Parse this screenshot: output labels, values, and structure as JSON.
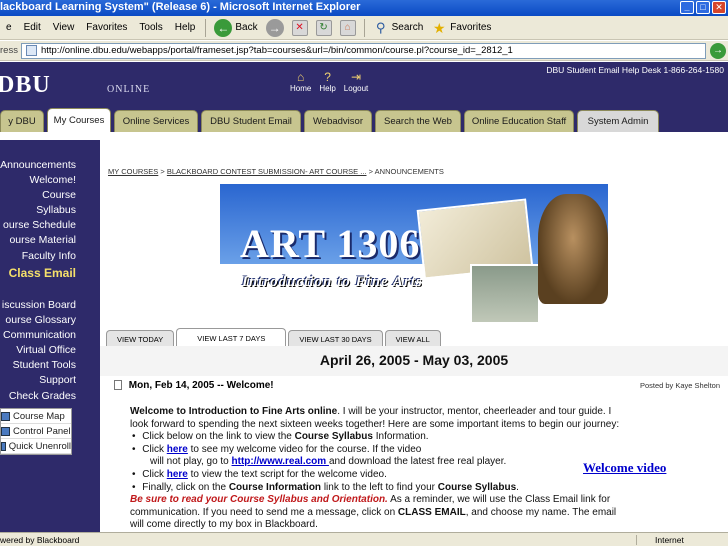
{
  "window": {
    "title": "lackboard Learning System\" (Release 6) - Microsoft Internet Explorer"
  },
  "menu": [
    "e",
    "Edit",
    "View",
    "Favorites",
    "Tools",
    "Help"
  ],
  "toolbar": {
    "back": "Back",
    "search": "Search",
    "favorites": "Favorites"
  },
  "address": {
    "label": "ress",
    "url": "http://online.dbu.edu/webapps/portal/frameset.jsp?tab=courses&url=/bin/common/course.pl?course_id=_2812_1"
  },
  "header": {
    "logo": "DBU",
    "online": "ONLINE",
    "icons": [
      {
        "name": "home-icon",
        "label": "Home"
      },
      {
        "name": "help-icon",
        "label": "Help"
      },
      {
        "name": "logout-icon",
        "label": "Logout"
      }
    ],
    "links": "DBU Student Email   Help Desk 1-866-264-1580"
  },
  "tabs": [
    {
      "label": "y DBU"
    },
    {
      "label": "My Courses"
    },
    {
      "label": "Online Services"
    },
    {
      "label": "DBU Student Email"
    },
    {
      "label": "Webadvisor"
    },
    {
      "label": "Search the Web"
    },
    {
      "label": "Online Education Staff"
    },
    {
      "label": "System Admin"
    }
  ],
  "leftnav": {
    "items_top": [
      "Announcements",
      "Welcome!",
      "Course Syllabus",
      "ourse Schedule",
      "ourse Material",
      "Faculty Info"
    ],
    "class_email": "Class Email",
    "items_bottom": [
      "iscussion Board",
      "ourse Glossary",
      "Communication",
      "Virtual Office",
      "Student Tools",
      "Support",
      "Check Grades"
    ],
    "tools": [
      "Course Map",
      "Control Panel",
      "Quick Unenroll"
    ]
  },
  "content": {
    "breadcrumb_1": "MY COURSES",
    "breadcrumb_2": "BLACKBOARD CONTEST SUBMISSION- ART COURSE ...",
    "breadcrumb_3": "ANNOUNCEMENTS",
    "banner_title": "ART 1306",
    "banner_subtitle": "Introduction to Fine Arts",
    "view_tabs": [
      "VIEW TODAY",
      "VIEW LAST 7 DAYS",
      "VIEW LAST 30 DAYS",
      "VIEW ALL"
    ],
    "date_range": "April 26, 2005 - May 03, 2005",
    "announcement_title": "Mon, Feb 14, 2005 -- Welcome!",
    "posted_by": "Posted by Kaye Shelton",
    "welcome_video": "Welcome video",
    "body": {
      "p1_bold": "Welcome to Introduction to Fine Arts online",
      "p1_rest": ". I will be your instructor, mentor, cheerleader and tour guide. I look forward to spending the next sixteen weeks together! Here are some important items to begin our journey:",
      "b1_a": "Click below on the link to view the ",
      "b1_b": "Course Syllabus",
      "b1_c": " Information.",
      "b2_a": "Click ",
      "b2_link": "here",
      "b2_b": " to see my welcome video for the course.  If the video",
      "b2_c": "will not play, go to  ",
      "b2_link2": "http://www.real.com ",
      "b2_d": "and download the latest free real player.",
      "b3_a": "Click ",
      "b3_link": "here",
      "b3_b": " to view the text script for the welcome video.",
      "b4_a": "Finally, click on the ",
      "b4_b": "Course Information",
      "b4_c": " link to the left to find your ",
      "b4_d": "Course Syllabus",
      "b4_e": ".",
      "p2_red": "Be sure to read your Course Syllabus and Orientation.",
      "p2_a": "  As a reminder, we will use the Class Email link for communication. If you need to send me a message, click on ",
      "p2_b": "CLASS EMAIL",
      "p2_c": ", and choose my name. The email will come directly to my box in Blackboard."
    }
  },
  "status": {
    "left": "wered by Blackboard",
    "zone": "Internet"
  }
}
